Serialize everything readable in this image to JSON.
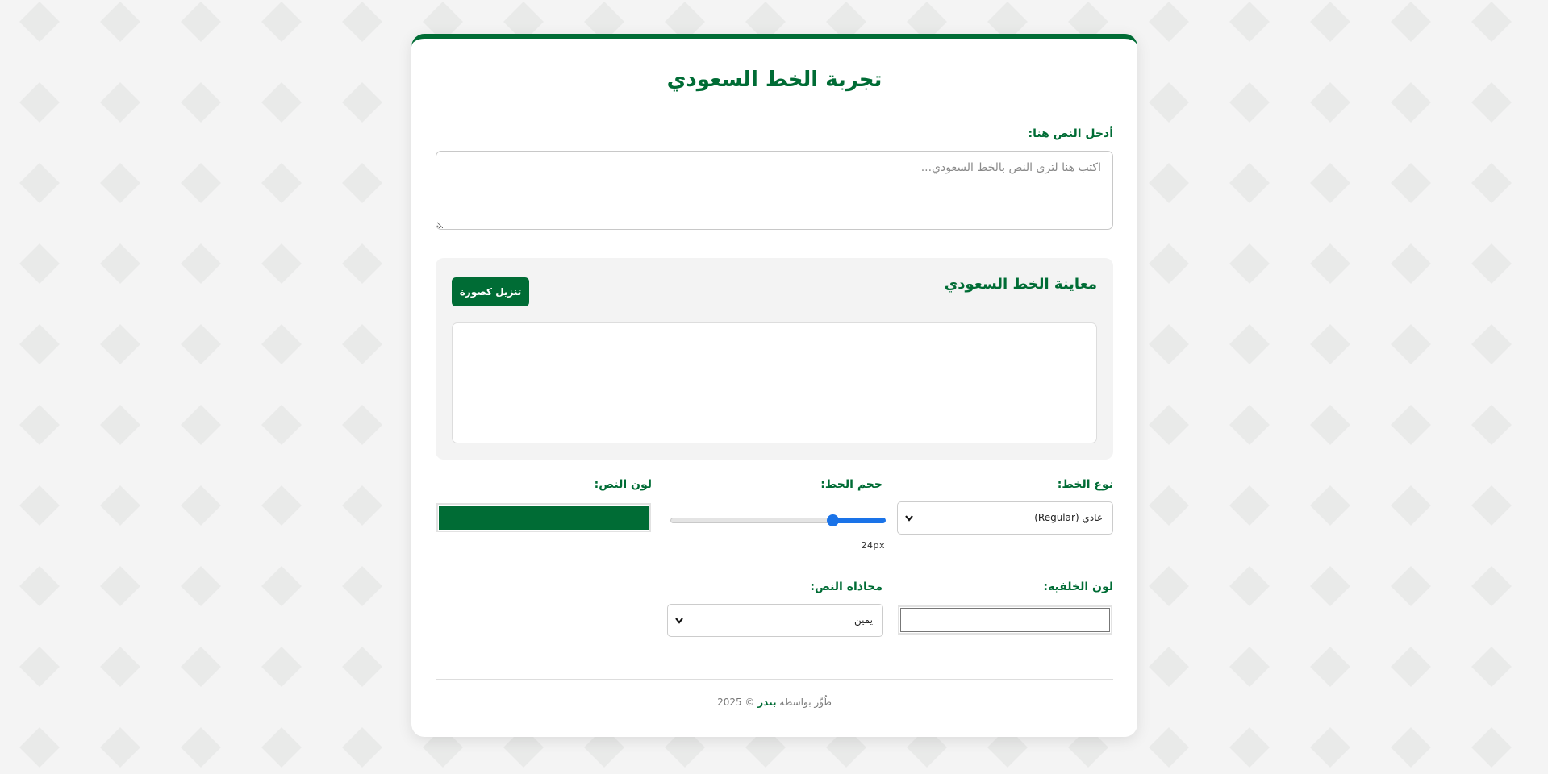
{
  "page": {
    "title": "تجربة الخط السعودي"
  },
  "input": {
    "label": "أدخل النص هنا:",
    "placeholder": "اكتب هنا لترى النص بالخط السعودي...",
    "value": ""
  },
  "preview": {
    "title": "معاينة الخط السعودي",
    "download_label": "تنزيل كصورة",
    "text": ""
  },
  "controls": {
    "font_type": {
      "label": "نوع الخط:",
      "selected": "عادي (Regular)"
    },
    "font_size": {
      "label": "حجم الخط:",
      "value": 24,
      "min": 12,
      "max": 28,
      "display": "24px"
    },
    "text_color": {
      "label": "لون النص:",
      "value": "#006c35"
    },
    "bg_color": {
      "label": "لون الخلفية:",
      "value": "#ffffff"
    },
    "alignment": {
      "label": "محاذاة النص:",
      "selected": "يمين"
    }
  },
  "footer": {
    "prefix": "طُوِّر بواسطة",
    "name": "بندر",
    "suffix": "© 2025"
  },
  "theme": {
    "accent": "#006c35",
    "slider": "#1a73e8",
    "pattern": "#e9eae9"
  },
  "icons": {
    "select_chevron": "chevron-down-icon"
  }
}
